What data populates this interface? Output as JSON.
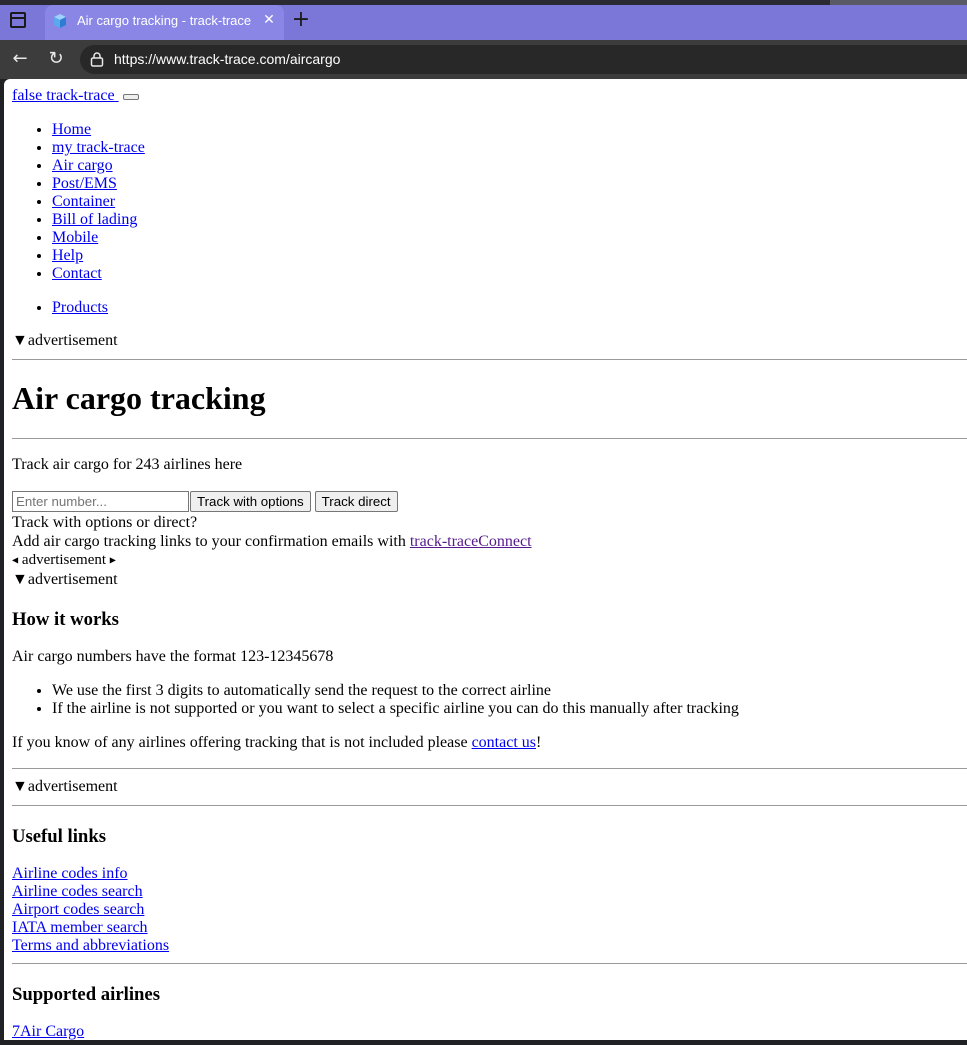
{
  "browser": {
    "tab_title": "Air cargo tracking - track-trace",
    "url": "https://www.track-trace.com/aircargo"
  },
  "header": {
    "logo_alt": "false track-trace"
  },
  "nav": {
    "items": [
      "Home",
      "my track-trace",
      "Air cargo",
      "Post/EMS",
      "Container",
      "Bill of lading",
      "Mobile",
      "Help",
      "Contact"
    ],
    "extra": "Products"
  },
  "advertisement_label": "advertisement",
  "main": {
    "title": "Air cargo tracking",
    "intro": "Track air cargo for 243 airlines here",
    "form": {
      "placeholder": "Enter number...",
      "track_options_label": "Track with options",
      "track_direct_label": "Track direct"
    },
    "track_question": "Track with options or direct?",
    "connect_text": "Add air cargo tracking links to your confirmation emails with ",
    "connect_link": "track-traceConnect"
  },
  "how_it_works": {
    "heading": "How it works",
    "format_text": "Air cargo numbers have the format 123-12345678",
    "bullets": [
      "We use the first 3 digits to automatically send the request to the correct airline",
      "If the airline is not supported or you want to select a specific airline you can do this manually after tracking"
    ],
    "contact_prefix": "If you know of any airlines offering tracking that is not included please ",
    "contact_link": "contact us",
    "contact_suffix": "!"
  },
  "useful_links": {
    "heading": "Useful links",
    "links": [
      "Airline codes info",
      "Airline codes search",
      "Airport codes search",
      "IATA member search",
      "Terms and abbreviations"
    ]
  },
  "supported_airlines": {
    "heading": "Supported airlines",
    "first": "7Air Cargo"
  }
}
